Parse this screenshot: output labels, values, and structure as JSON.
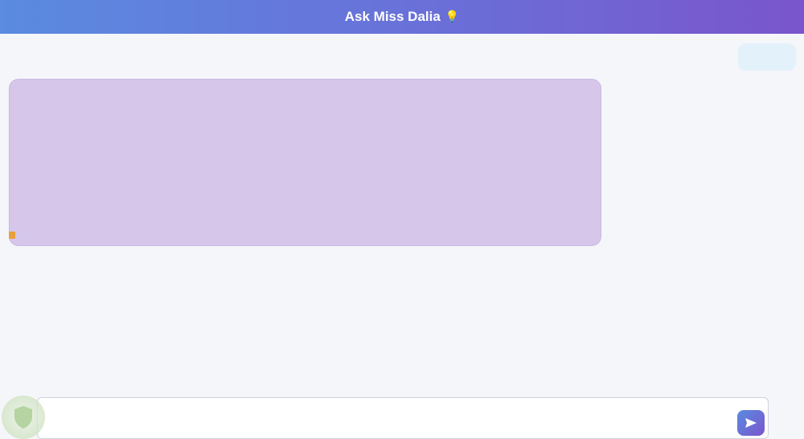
{
  "app": {
    "title": "Ask Miss Dalia",
    "title_icon": "lightbulb-icon"
  },
  "chat": {
    "user_message": "",
    "bot_message": {
      "lines": [
        "",
        "",
        "",
        "",
        "",
        "",
        "",
        "",
        "",
        "",
        "",
        ""
      ]
    },
    "copy_label": ""
  },
  "composer": {
    "placeholder": "",
    "send_icon": "send-arrow-icon"
  },
  "colors": {
    "header_start": "#5a8be0",
    "header_end": "#7a55cc",
    "user_bubble": "#e3f1fb",
    "bot_bubble": "#d6c7ea"
  }
}
